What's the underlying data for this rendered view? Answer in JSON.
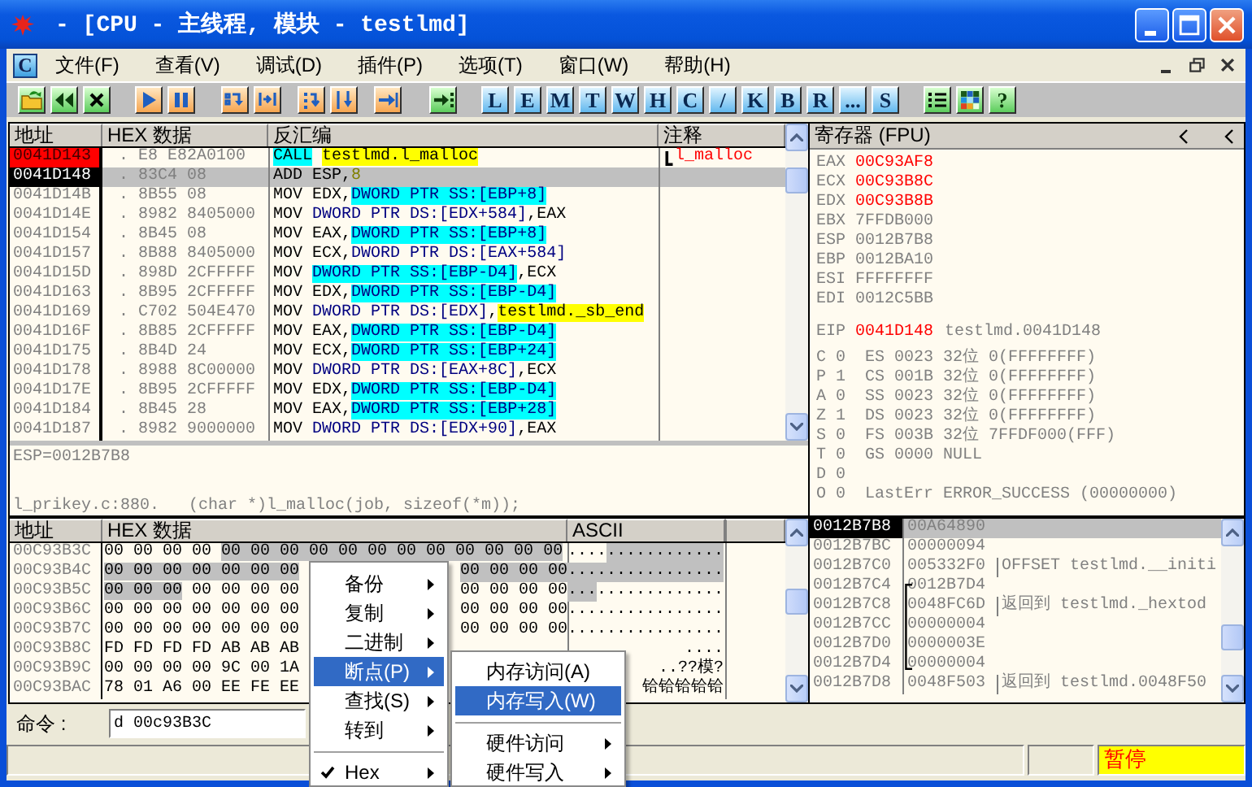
{
  "window": {
    "title": "- [CPU - 主线程, 模块 - testlmd]"
  },
  "menubar": {
    "badge": "C",
    "items": [
      "文件(F)",
      "查看(V)",
      "调试(D)",
      "插件(P)",
      "选项(T)",
      "窗口(W)",
      "帮助(H)"
    ]
  },
  "toolbar": {
    "letter_buttons": [
      "L",
      "E",
      "M",
      "T",
      "W",
      "H",
      "C",
      "/",
      "K",
      "B",
      "R",
      "...",
      "S"
    ],
    "help_button": "?"
  },
  "disassembly": {
    "columns": [
      "地址",
      "HEX 数据",
      "反汇编",
      "注释"
    ],
    "rows": [
      {
        "address": "0041D143",
        "path": ".",
        "hex": "E8 E82A0100",
        "mnemonic": "CALL",
        "mnemonic_highlighted": true,
        "operands": [
          {
            "text": "testlmd.l_malloc",
            "kind": "label"
          }
        ],
        "comment": "l_malloc",
        "breakpoint": true,
        "selected": false
      },
      {
        "address": "0041D148",
        "path": ".",
        "hex": "83C4 08",
        "mnemonic": "ADD",
        "mnemonic_highlighted": false,
        "operands": [
          {
            "text": "ESP,",
            "kind": "plain"
          },
          {
            "text": "8",
            "kind": "num"
          }
        ],
        "breakpoint": false,
        "selected": true
      },
      {
        "address": "0041D14B",
        "path": ".",
        "hex": "8B55 08",
        "mnemonic": "MOV",
        "mnemonic_highlighted": false,
        "operands": [
          {
            "text": "EDX,",
            "kind": "plain"
          },
          {
            "text": "DWORD PTR SS:[EBP+8]",
            "kind": "stack"
          }
        ],
        "breakpoint": false,
        "selected": false
      },
      {
        "address": "0041D14E",
        "path": ".",
        "hex": "8982 8405000",
        "mnemonic": "MOV",
        "mnemonic_highlighted": false,
        "operands": [
          {
            "text": "DWORD PTR DS:[EDX+584]",
            "kind": "mem"
          },
          {
            "text": ",EAX",
            "kind": "plain"
          }
        ],
        "breakpoint": false,
        "selected": false
      },
      {
        "address": "0041D154",
        "path": ".",
        "hex": "8B45 08",
        "mnemonic": "MOV",
        "mnemonic_highlighted": false,
        "operands": [
          {
            "text": "EAX,",
            "kind": "plain"
          },
          {
            "text": "DWORD PTR SS:[EBP+8]",
            "kind": "stack"
          }
        ],
        "breakpoint": false,
        "selected": false
      },
      {
        "address": "0041D157",
        "path": ".",
        "hex": "8B88 8405000",
        "mnemonic": "MOV",
        "mnemonic_highlighted": false,
        "operands": [
          {
            "text": "ECX,",
            "kind": "plain"
          },
          {
            "text": "DWORD PTR DS:[EAX+584]",
            "kind": "mem"
          }
        ],
        "breakpoint": false,
        "selected": false
      },
      {
        "address": "0041D15D",
        "path": ".",
        "hex": "898D 2CFFFFF",
        "mnemonic": "MOV",
        "mnemonic_highlighted": false,
        "operands": [
          {
            "text": "DWORD PTR SS:[EBP-D4]",
            "kind": "stack"
          },
          {
            "text": ",ECX",
            "kind": "plain"
          }
        ],
        "breakpoint": false,
        "selected": false
      },
      {
        "address": "0041D163",
        "path": ".",
        "hex": "8B95 2CFFFFF",
        "mnemonic": "MOV",
        "mnemonic_highlighted": false,
        "operands": [
          {
            "text": "EDX,",
            "kind": "plain"
          },
          {
            "text": "DWORD PTR SS:[EBP-D4]",
            "kind": "stack"
          }
        ],
        "breakpoint": false,
        "selected": false
      },
      {
        "address": "0041D169",
        "path": ".",
        "hex": "C702 504E470",
        "mnemonic": "MOV",
        "mnemonic_highlighted": false,
        "operands": [
          {
            "text": "DWORD PTR DS:[EDX]",
            "kind": "mem"
          },
          {
            "text": ",",
            "kind": "plain"
          },
          {
            "text": "testlmd._sb_end",
            "kind": "label"
          }
        ],
        "breakpoint": false,
        "selected": false
      },
      {
        "address": "0041D16F",
        "path": ".",
        "hex": "8B85 2CFFFFF",
        "mnemonic": "MOV",
        "mnemonic_highlighted": false,
        "operands": [
          {
            "text": "EAX,",
            "kind": "plain"
          },
          {
            "text": "DWORD PTR SS:[EBP-D4]",
            "kind": "stack"
          }
        ],
        "breakpoint": false,
        "selected": false
      },
      {
        "address": "0041D175",
        "path": ".",
        "hex": "8B4D 24",
        "mnemonic": "MOV",
        "mnemonic_highlighted": false,
        "operands": [
          {
            "text": "ECX,",
            "kind": "plain"
          },
          {
            "text": "DWORD PTR SS:[EBP+24]",
            "kind": "stack"
          }
        ],
        "breakpoint": false,
        "selected": false
      },
      {
        "address": "0041D178",
        "path": ".",
        "hex": "8988 8C00000",
        "mnemonic": "MOV",
        "mnemonic_highlighted": false,
        "operands": [
          {
            "text": "DWORD PTR DS:[EAX+8C]",
            "kind": "mem"
          },
          {
            "text": ",ECX",
            "kind": "plain"
          }
        ],
        "breakpoint": false,
        "selected": false
      },
      {
        "address": "0041D17E",
        "path": ".",
        "hex": "8B95 2CFFFFF",
        "mnemonic": "MOV",
        "mnemonic_highlighted": false,
        "operands": [
          {
            "text": "EDX,",
            "kind": "plain"
          },
          {
            "text": "DWORD PTR SS:[EBP-D4]",
            "kind": "stack"
          }
        ],
        "breakpoint": false,
        "selected": false
      },
      {
        "address": "0041D184",
        "path": ".",
        "hex": "8B45 28",
        "mnemonic": "MOV",
        "mnemonic_highlighted": false,
        "operands": [
          {
            "text": "EAX,",
            "kind": "plain"
          },
          {
            "text": "DWORD PTR SS:[EBP+28]",
            "kind": "stack"
          }
        ],
        "breakpoint": false,
        "selected": false
      },
      {
        "address": "0041D187",
        "path": ".",
        "hex": "8982 9000000",
        "mnemonic": "MOV",
        "mnemonic_highlighted": false,
        "operands": [
          {
            "text": "DWORD PTR DS:[EDX+90]",
            "kind": "mem"
          },
          {
            "text": ",EAX",
            "kind": "plain"
          }
        ],
        "breakpoint": false,
        "selected": false
      }
    ],
    "info": [
      "ESP=0012B7B8",
      "l_prikey.c:880.   (char *)l_malloc(job, sizeof(*m));"
    ]
  },
  "registers": {
    "title": "寄存器 (FPU)",
    "general": [
      {
        "name": "EAX",
        "value": "00C93AF8",
        "changed": true
      },
      {
        "name": "ECX",
        "value": "00C93B8C",
        "changed": true
      },
      {
        "name": "EDX",
        "value": "00C93B8B",
        "changed": true
      },
      {
        "name": "EBX",
        "value": "7FFDB000",
        "changed": false
      },
      {
        "name": "ESP",
        "value": "0012B7B8",
        "changed": false
      },
      {
        "name": "EBP",
        "value": "0012BA10",
        "changed": false
      },
      {
        "name": "ESI",
        "value": "FFFFFFFF",
        "changed": false
      },
      {
        "name": "EDI",
        "value": "0012C5BB",
        "changed": false
      }
    ],
    "eip": {
      "name": "EIP",
      "value": "0041D148",
      "changed": true,
      "comment": "testlmd.0041D148"
    },
    "flags": [
      {
        "flag": "C",
        "bit": "0",
        "info": "ES 0023 32位 0(FFFFFFFF)"
      },
      {
        "flag": "P",
        "bit": "1",
        "info": "CS 001B 32位 0(FFFFFFFF)"
      },
      {
        "flag": "A",
        "bit": "0",
        "info": "SS 0023 32位 0(FFFFFFFF)"
      },
      {
        "flag": "Z",
        "bit": "1",
        "info": "DS 0023 32位 0(FFFFFFFF)"
      },
      {
        "flag": "S",
        "bit": "0",
        "info": "FS 003B 32位 7FFDF000(FFF)"
      },
      {
        "flag": "T",
        "bit": "0",
        "info": "GS 0000 NULL"
      },
      {
        "flag": "D",
        "bit": "0"
      },
      {
        "flag": "O",
        "bit": "0",
        "info": "LastErr ERROR_SUCCESS (00000000)"
      }
    ]
  },
  "dump": {
    "columns": [
      "地址",
      "HEX 数据",
      "ASCII"
    ],
    "rows": [
      {
        "address": "00C93B3C",
        "hex": [
          {
            "text": "00 00 00 00",
            "selected": false
          },
          {
            "text": "00 00 00 00 00 00 00 00 00 00 00 00",
            "selected": true
          }
        ],
        "ascii": [
          {
            "text": "....",
            "selected": false
          },
          {
            "text": "............",
            "selected": true
          }
        ]
      },
      {
        "address": "00C93B4C",
        "hex": [
          {
            "text": "00 00 00 00 00 00 00",
            "selected": true
          }
        ],
        "hex_right": {
          "text": "00 00 00 00",
          "selected": true
        },
        "ascii": [
          {
            "text": "................",
            "selected": true
          }
        ]
      },
      {
        "address": "00C93B5C",
        "hex": [
          {
            "text": "00 00 00",
            "selected": true
          },
          {
            "text": "00 00 00 00",
            "selected": false
          }
        ],
        "hex_right": {
          "text": "00 00 00 00",
          "selected": false
        },
        "ascii": [
          {
            "text": "...",
            "selected": true
          },
          {
            "text": ".............",
            "selected": false
          }
        ]
      },
      {
        "address": "00C93B6C",
        "hex": [
          {
            "text": "00 00 00 00 00 00 00",
            "selected": false
          }
        ],
        "hex_right": {
          "text": "00 00 00 00",
          "selected": false
        },
        "ascii": [
          {
            "text": "................",
            "selected": false
          }
        ]
      },
      {
        "address": "00C93B7C",
        "hex": [
          {
            "text": "00 00 00 00 00 00 00",
            "selected": false
          }
        ],
        "hex_right": {
          "text": "00 00 00 00",
          "selected": false
        },
        "ascii": [
          {
            "text": "................",
            "selected": false
          }
        ]
      },
      {
        "address": "00C93B8C",
        "hex": [
          {
            "text": "FD FD FD FD AB AB AB",
            "selected": false
          }
        ],
        "ascii": [
          {
            "text": "....",
            "selected": false
          }
        ]
      },
      {
        "address": "00C93B9C",
        "hex": [
          {
            "text": "00 00 00 00 9C 00 1A",
            "selected": false
          }
        ],
        "ascii": [
          {
            "text": "..??模?",
            "selected": false
          }
        ]
      },
      {
        "address": "00C93BAC",
        "hex": [
          {
            "text": "78 01 A6 00 EE FE EE",
            "selected": false
          }
        ],
        "ascii": [
          {
            "text": "铪铪铪铪铪",
            "selected": false
          }
        ]
      }
    ]
  },
  "stack": {
    "rows": [
      {
        "address": "0012B7B8",
        "value": "00A64890",
        "selected": true,
        "in_frame": false
      },
      {
        "address": "0012B7BC",
        "value": "00000094",
        "selected": false,
        "in_frame": false
      },
      {
        "address": "0012B7C0",
        "value": "005332F0",
        "comment": "OFFSET testlmd.__initi",
        "selected": false,
        "in_frame": false
      },
      {
        "address": "0012B7C4",
        "value": "0012B7D4",
        "selected": false,
        "in_frame": true
      },
      {
        "address": "0012B7C8",
        "value": "0048FC6D",
        "comment": "返回到 testlmd._hextod",
        "selected": false,
        "in_frame": true
      },
      {
        "address": "0012B7CC",
        "value": "00000004",
        "selected": false,
        "in_frame": true
      },
      {
        "address": "0012B7D0",
        "value": "0000003E",
        "selected": false,
        "in_frame": true
      },
      {
        "address": "0012B7D4",
        "value": "00000004",
        "selected": false,
        "in_frame": true
      },
      {
        "address": "0012B7D8",
        "value": "0048F503",
        "comment": "返回到 testlmd.0048F50",
        "selected": false,
        "in_frame": false
      }
    ]
  },
  "command": {
    "label": "命令 :",
    "value": "d 00c93B3C"
  },
  "status_bar": {
    "state": "暂停"
  },
  "context_menu": [
    {
      "kind": "item",
      "label": "备份",
      "submenu": true,
      "selected": false,
      "checked": false
    },
    {
      "kind": "item",
      "label": "复制",
      "submenu": true,
      "selected": false,
      "checked": false
    },
    {
      "kind": "item",
      "label": "二进制",
      "submenu": true,
      "selected": false,
      "checked": false
    },
    {
      "kind": "item",
      "label": "断点(P)",
      "submenu": true,
      "selected": true,
      "checked": false
    },
    {
      "kind": "item",
      "label": "查找(S)",
      "submenu": true,
      "selected": false,
      "checked": false
    },
    {
      "kind": "item",
      "label": "转到",
      "submenu": true,
      "selected": false,
      "checked": false
    },
    {
      "kind": "separator"
    },
    {
      "kind": "item",
      "label": "Hex",
      "submenu": true,
      "selected": false,
      "checked": true
    }
  ],
  "submenu": [
    {
      "kind": "item",
      "label": "内存访问(A)",
      "submenu": false,
      "selected": false
    },
    {
      "kind": "item",
      "label": "内存写入(W)",
      "submenu": false,
      "selected": true
    },
    {
      "kind": "separator"
    },
    {
      "kind": "item",
      "label": "硬件访问",
      "submenu": true,
      "selected": false
    },
    {
      "kind": "item",
      "label": "硬件写入",
      "submenu": true,
      "selected": false
    }
  ]
}
